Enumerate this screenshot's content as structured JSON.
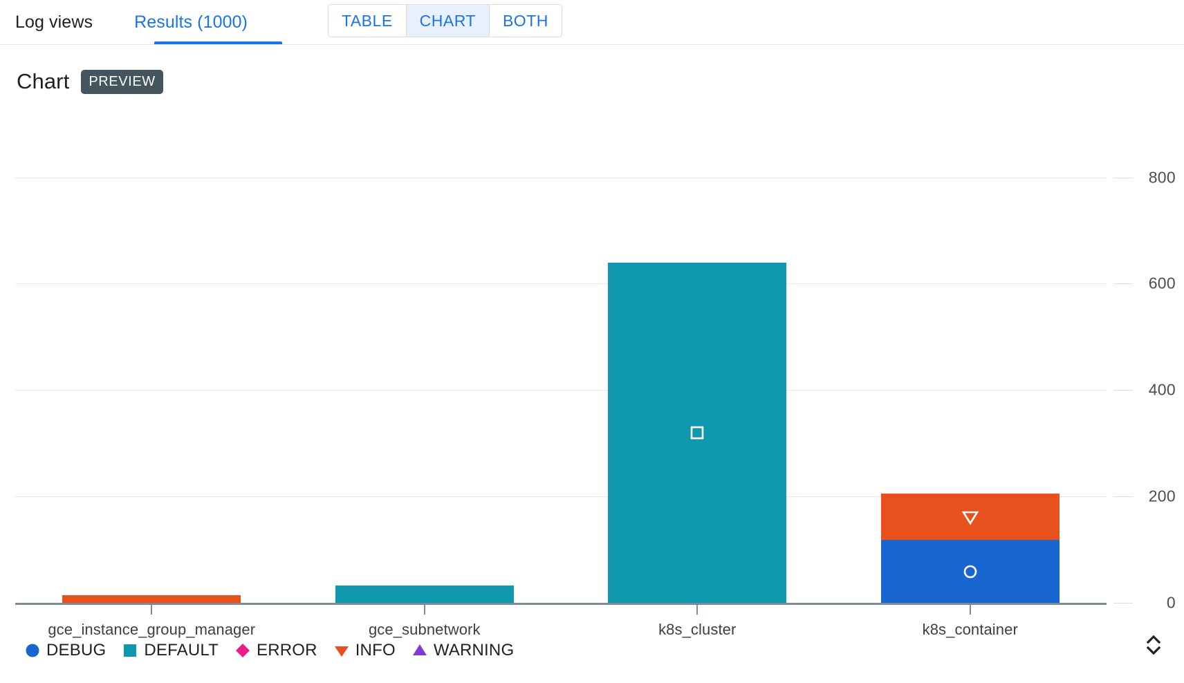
{
  "tabs": {
    "log_views": "Log views",
    "results": "Results (1000)"
  },
  "view_toggle": {
    "options": [
      "TABLE",
      "CHART",
      "BOTH"
    ],
    "selected": "CHART"
  },
  "chart_header": {
    "title": "Chart",
    "badge": "PREVIEW"
  },
  "icons": {
    "expand": "expand-collapse-icon"
  },
  "colors": {
    "accent_blue": "#1a73e8",
    "debug": "#1a66d0",
    "default": "#1099ae",
    "error": "#e91e8c",
    "info": "#e8501e",
    "warning": "#8338d8",
    "badge_bg": "#44555f",
    "gridline": "#e8e8e8",
    "axis": "#7e8a93"
  },
  "chart_data": {
    "type": "bar",
    "stacked": true,
    "title": "Chart",
    "xlabel": "",
    "ylabel": "",
    "ylim": [
      0,
      880
    ],
    "yticks": [
      0,
      200,
      400,
      600,
      800
    ],
    "grid": true,
    "legend_position": "bottom-left",
    "categories": [
      "gce_instance_group_manager",
      "gce_subnetwork",
      "k8s_cluster",
      "k8s_container"
    ],
    "series": [
      {
        "name": "DEBUG",
        "color": "#1a66d0",
        "marker": "circle",
        "values": [
          0,
          0,
          0,
          118
        ]
      },
      {
        "name": "DEFAULT",
        "color": "#1099ae",
        "marker": "square",
        "values": [
          0,
          33,
          640,
          0
        ]
      },
      {
        "name": "ERROR",
        "color": "#e91e8c",
        "marker": "diamond",
        "values": [
          0,
          0,
          0,
          0
        ]
      },
      {
        "name": "INFO",
        "color": "#e8501e",
        "marker": "triangle-down",
        "values": [
          14,
          0,
          0,
          88
        ]
      },
      {
        "name": "WARNING",
        "color": "#8338d8",
        "marker": "triangle-up",
        "values": [
          0,
          0,
          0,
          0
        ]
      }
    ]
  }
}
